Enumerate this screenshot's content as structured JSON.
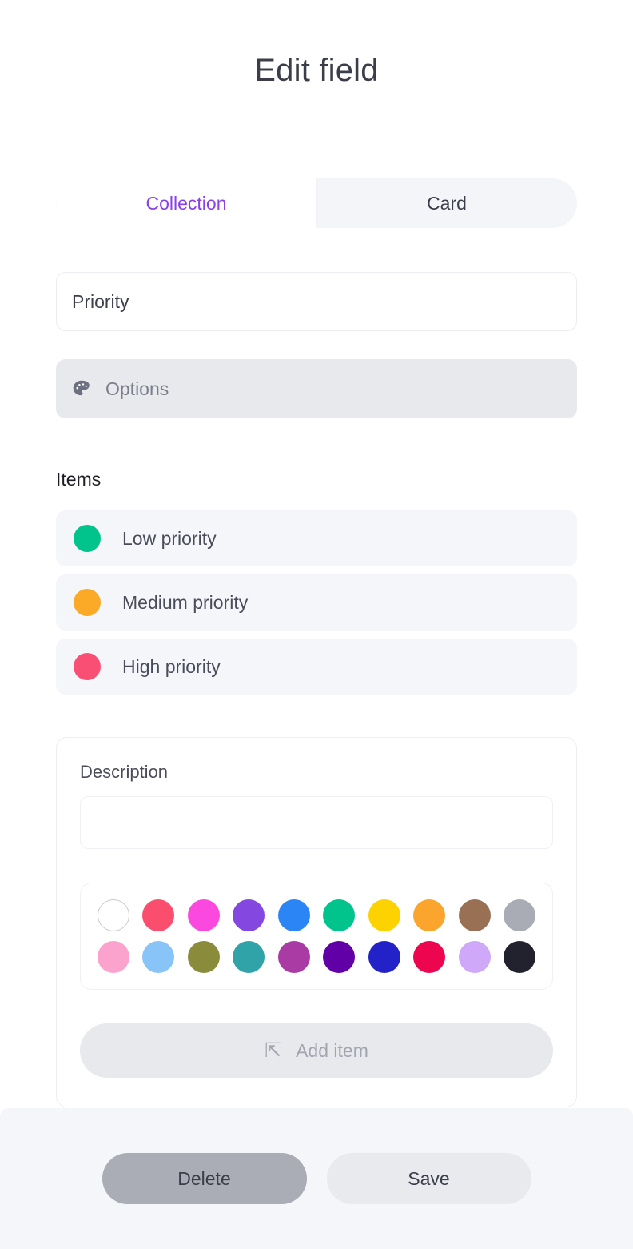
{
  "header": {
    "title": "Edit field"
  },
  "tabs": {
    "items": [
      {
        "label": "Collection",
        "active": true
      },
      {
        "label": "Card",
        "active": false
      }
    ],
    "active_color": "#8b3fe8"
  },
  "name_field": {
    "value": "Priority",
    "placeholder": "Field name"
  },
  "options_row": {
    "label": "Options",
    "icon": "palette-icon"
  },
  "items_section": {
    "heading": "Items",
    "items": [
      {
        "label": "Low priority",
        "color": "#00c48c"
      },
      {
        "label": "Medium priority",
        "color": "#fbaa28"
      },
      {
        "label": "High priority",
        "color": "#fa4f75"
      }
    ]
  },
  "editor_card": {
    "description_label": "Description",
    "description_value": "",
    "description_placeholder": "",
    "palette": {
      "rows": [
        [
          {
            "color": "#ffffff",
            "outlined": true
          },
          {
            "color": "#fb4e6e",
            "outlined": false
          },
          {
            "color": "#fb49e0",
            "outlined": false
          },
          {
            "color": "#8447e0",
            "outlined": false
          },
          {
            "color": "#2b85f5",
            "outlined": false
          },
          {
            "color": "#00c48c",
            "outlined": false
          },
          {
            "color": "#fcd200",
            "outlined": false
          },
          {
            "color": "#fba52e",
            "outlined": false
          },
          {
            "color": "#9a7055",
            "outlined": false
          },
          {
            "color": "#a9abb5",
            "outlined": false
          }
        ],
        [
          {
            "color": "#fba2cd",
            "outlined": false
          },
          {
            "color": "#88c4f7",
            "outlined": false
          },
          {
            "color": "#8b8b3c",
            "outlined": false
          },
          {
            "color": "#2fa3a8",
            "outlined": false
          },
          {
            "color": "#ab3ba4",
            "outlined": false
          },
          {
            "color": "#6200a8",
            "outlined": false
          },
          {
            "color": "#2222c8",
            "outlined": false
          },
          {
            "color": "#ed0550",
            "outlined": false
          },
          {
            "color": "#d0a8fa",
            "outlined": false
          },
          {
            "color": "#22222e",
            "outlined": false
          }
        ]
      ]
    },
    "add_item": {
      "label": "Add item",
      "icon": "return-arrow-icon"
    }
  },
  "footer": {
    "delete_label": "Delete",
    "save_label": "Save"
  }
}
